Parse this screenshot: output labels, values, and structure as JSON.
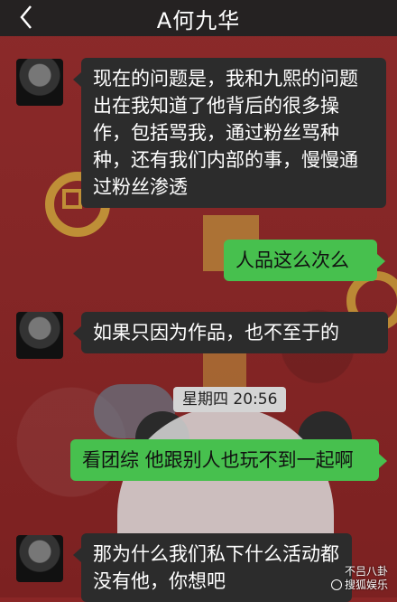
{
  "header": {
    "title": "A何九华"
  },
  "messages": [
    {
      "side": "left",
      "text": "现在的问题是，我和九熙的问题出在我知道了他背后的很多操作，包括骂我，通过粉丝骂种种，还有我们内部的事，慢慢通过粉丝渗透"
    },
    {
      "side": "right",
      "text": "人品这么次么"
    },
    {
      "side": "left",
      "text": "如果只因为作品，也不至于的"
    },
    {
      "side": "right",
      "text": "看团综 他跟别人也玩不到一起啊"
    },
    {
      "side": "left",
      "text": "那为什么我们私下什么活动都没有他，你想吧"
    }
  ],
  "timestamp": "星期四 20:56",
  "watermark": {
    "line1": "不吕八卦",
    "line2": "搜狐娱乐"
  },
  "colors": {
    "left_bubble": "#2c2c2c",
    "right_bubble": "#47c04e",
    "header": "#252222",
    "background": "#8a2626"
  },
  "icons": {
    "back": "chevron-left-icon",
    "avatar": "contact-avatar"
  }
}
